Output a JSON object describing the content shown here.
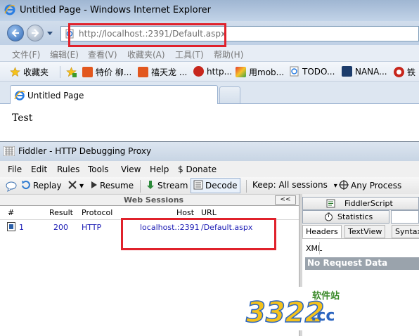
{
  "ie": {
    "window_title": "Untitled Page - Windows Internet Explorer",
    "address_url": "http://localhost.:2391/Default.aspx",
    "menu": [
      "文件(F)",
      "编辑(E)",
      "查看(V)",
      "收藏夹(A)",
      "工具(T)",
      "帮助(H)"
    ],
    "favorites_label": "收藏夹",
    "favorites": [
      "特价 柳...",
      "禧天龙 ...",
      "http...",
      "用mob...",
      "TODO...",
      "NANA...",
      "铁"
    ],
    "tab_title": "Untitled Page",
    "page_text": "Test"
  },
  "fiddler": {
    "window_title": "Fiddler - HTTP Debugging Proxy",
    "menu": [
      "File",
      "Edit",
      "Rules",
      "Tools",
      "View",
      "Help",
      "$ Donate"
    ],
    "toolbar": {
      "replay": "Replay",
      "remove": "▾",
      "resume": "Resume",
      "stream": "Stream",
      "decode": "Decode",
      "keep": "Keep: All sessions",
      "keep_arrow": "▾",
      "process": "Any Process"
    },
    "web_sessions_title": "Web Sessions",
    "collapse": "<<",
    "columns": [
      "#",
      "Result",
      "Protocol",
      "Host",
      "URL"
    ],
    "sessions": [
      {
        "num": "1",
        "result": "200",
        "protocol": "HTTP",
        "host": "localhost.:2391",
        "url": "/Default.aspx"
      }
    ],
    "right_tabs": {
      "fiddlerscript": "FiddlerScript",
      "statistics": "Statistics",
      "sub_tabs": [
        "Headers",
        "TextView",
        "Syntax"
      ],
      "xml": "XML",
      "no_request": "No Request Data"
    }
  },
  "watermark": {
    "logo_text": "3322.cc",
    "sub_text": "软件站"
  },
  "colors": {
    "highlight_box": "#e0212b",
    "link_blue": "#1a1ab4"
  }
}
